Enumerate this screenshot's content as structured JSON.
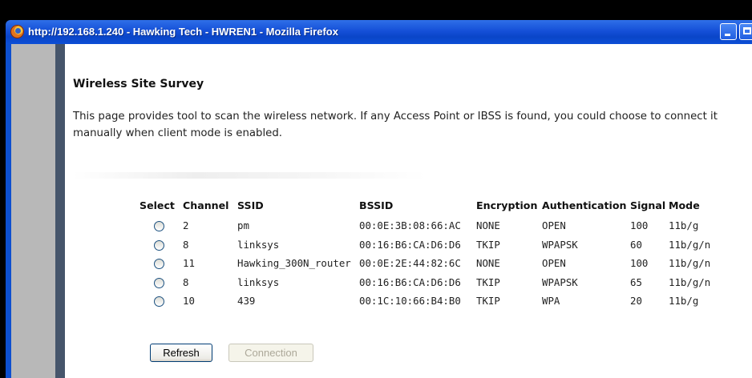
{
  "window": {
    "title": "http://192.168.1.240 - Hawking Tech - HWREN1 - Mozilla Firefox"
  },
  "page": {
    "heading": "Wireless Site Survey",
    "description": "This page provides tool to scan the wireless network. If any Access Point or IBSS is found, you could choose to connect it manually when client mode is enabled."
  },
  "table": {
    "headers": {
      "select": "Select",
      "channel": "Channel",
      "ssid": "SSID",
      "bssid": "BSSID",
      "encryption": "Encryption",
      "authentication": "Authentication",
      "signal": "Signal",
      "mode": "Mode"
    },
    "rows": [
      {
        "channel": "2",
        "ssid": "pm",
        "bssid": "00:0E:3B:08:66:AC",
        "encryption": "NONE",
        "authentication": "OPEN",
        "signal": "100",
        "mode": "11b/g"
      },
      {
        "channel": "8",
        "ssid": "linksys",
        "bssid": "00:16:B6:CA:D6:D6",
        "encryption": "TKIP",
        "authentication": "WPAPSK",
        "signal": "60",
        "mode": "11b/g/n"
      },
      {
        "channel": "11",
        "ssid": "Hawking_300N_router",
        "bssid": "00:0E:2E:44:82:6C",
        "encryption": "NONE",
        "authentication": "OPEN",
        "signal": "100",
        "mode": "11b/g/n"
      },
      {
        "channel": "8",
        "ssid": "linksys",
        "bssid": "00:16:B6:CA:D6:D6",
        "encryption": "TKIP",
        "authentication": "WPAPSK",
        "signal": "65",
        "mode": "11b/g/n"
      },
      {
        "channel": "10",
        "ssid": "439",
        "bssid": "00:1C:10:66:B4:B0",
        "encryption": "TKIP",
        "authentication": "WPA",
        "signal": "20",
        "mode": "11b/g"
      }
    ]
  },
  "buttons": {
    "refresh": "Refresh",
    "connection": "Connection"
  }
}
